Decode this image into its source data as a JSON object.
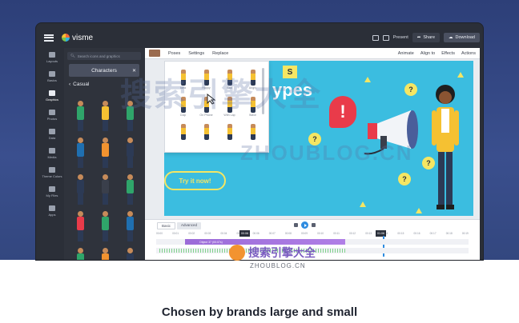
{
  "app": {
    "brand": "visme",
    "top_actions": {
      "present": "Present",
      "share": "Share",
      "download": "Download"
    }
  },
  "left_rail": [
    {
      "label": "Layouts",
      "icon": "layout-icon"
    },
    {
      "label": "Basics",
      "icon": "basics-icon"
    },
    {
      "label": "Graphics",
      "icon": "graphics-icon",
      "active": true
    },
    {
      "label": "Photos",
      "icon": "photo-icon"
    },
    {
      "label": "Data",
      "icon": "chart-icon"
    },
    {
      "label": "Media",
      "icon": "media-icon"
    },
    {
      "label": "Theme Colors",
      "icon": "palette-icon"
    },
    {
      "label": "My Files",
      "icon": "folder-icon"
    },
    {
      "label": "Apps",
      "icon": "apps-icon"
    }
  ],
  "panel": {
    "search_placeholder": "Search icons and graphics",
    "category": "Characters",
    "subcategory": "Casual"
  },
  "toolbar": {
    "items": [
      "Poses",
      "Settings",
      "Replace"
    ],
    "right_items": [
      "Animate",
      "Align to",
      "Effects",
      "Actions"
    ]
  },
  "poses_panel": {
    "labels": [
      "Idea",
      "Happy",
      "Sad",
      "Angry",
      "Clap",
      "On Phone",
      "With Lap",
      "Wave",
      "",
      "",
      "",
      ""
    ]
  },
  "slide": {
    "badge": "S",
    "headline_fragment": "ypes",
    "cta": "Try it now!",
    "bubble": "!",
    "qmark": "?"
  },
  "timeline": {
    "tabs": [
      "Basic",
      "Advanced"
    ],
    "ticks": [
      "00:00",
      "00:01",
      "00:02",
      "00:03",
      "00:04",
      "00:05",
      "00:06",
      "00:07",
      "00:08",
      "00:09",
      "00:10",
      "00:11",
      "00:12",
      "00:13",
      "00:14",
      "00:15",
      "00:16",
      "00:17",
      "00:18",
      "00:19"
    ],
    "marker_left": "00:06",
    "marker_right": "01:06",
    "track_label": "Object 37 (00:07s)"
  },
  "watermark": {
    "cn": "搜索引擎大全",
    "en": "ZHOUBLOG.CN"
  },
  "page": {
    "tagline": "Chosen by brands large and small"
  },
  "colors": {
    "hero_bg": "#33477f",
    "slide_bg": "#3bbde0",
    "accent_yellow": "#f5e663",
    "accent_red": "#e93b4a",
    "timeline_purple": "#a574de"
  }
}
